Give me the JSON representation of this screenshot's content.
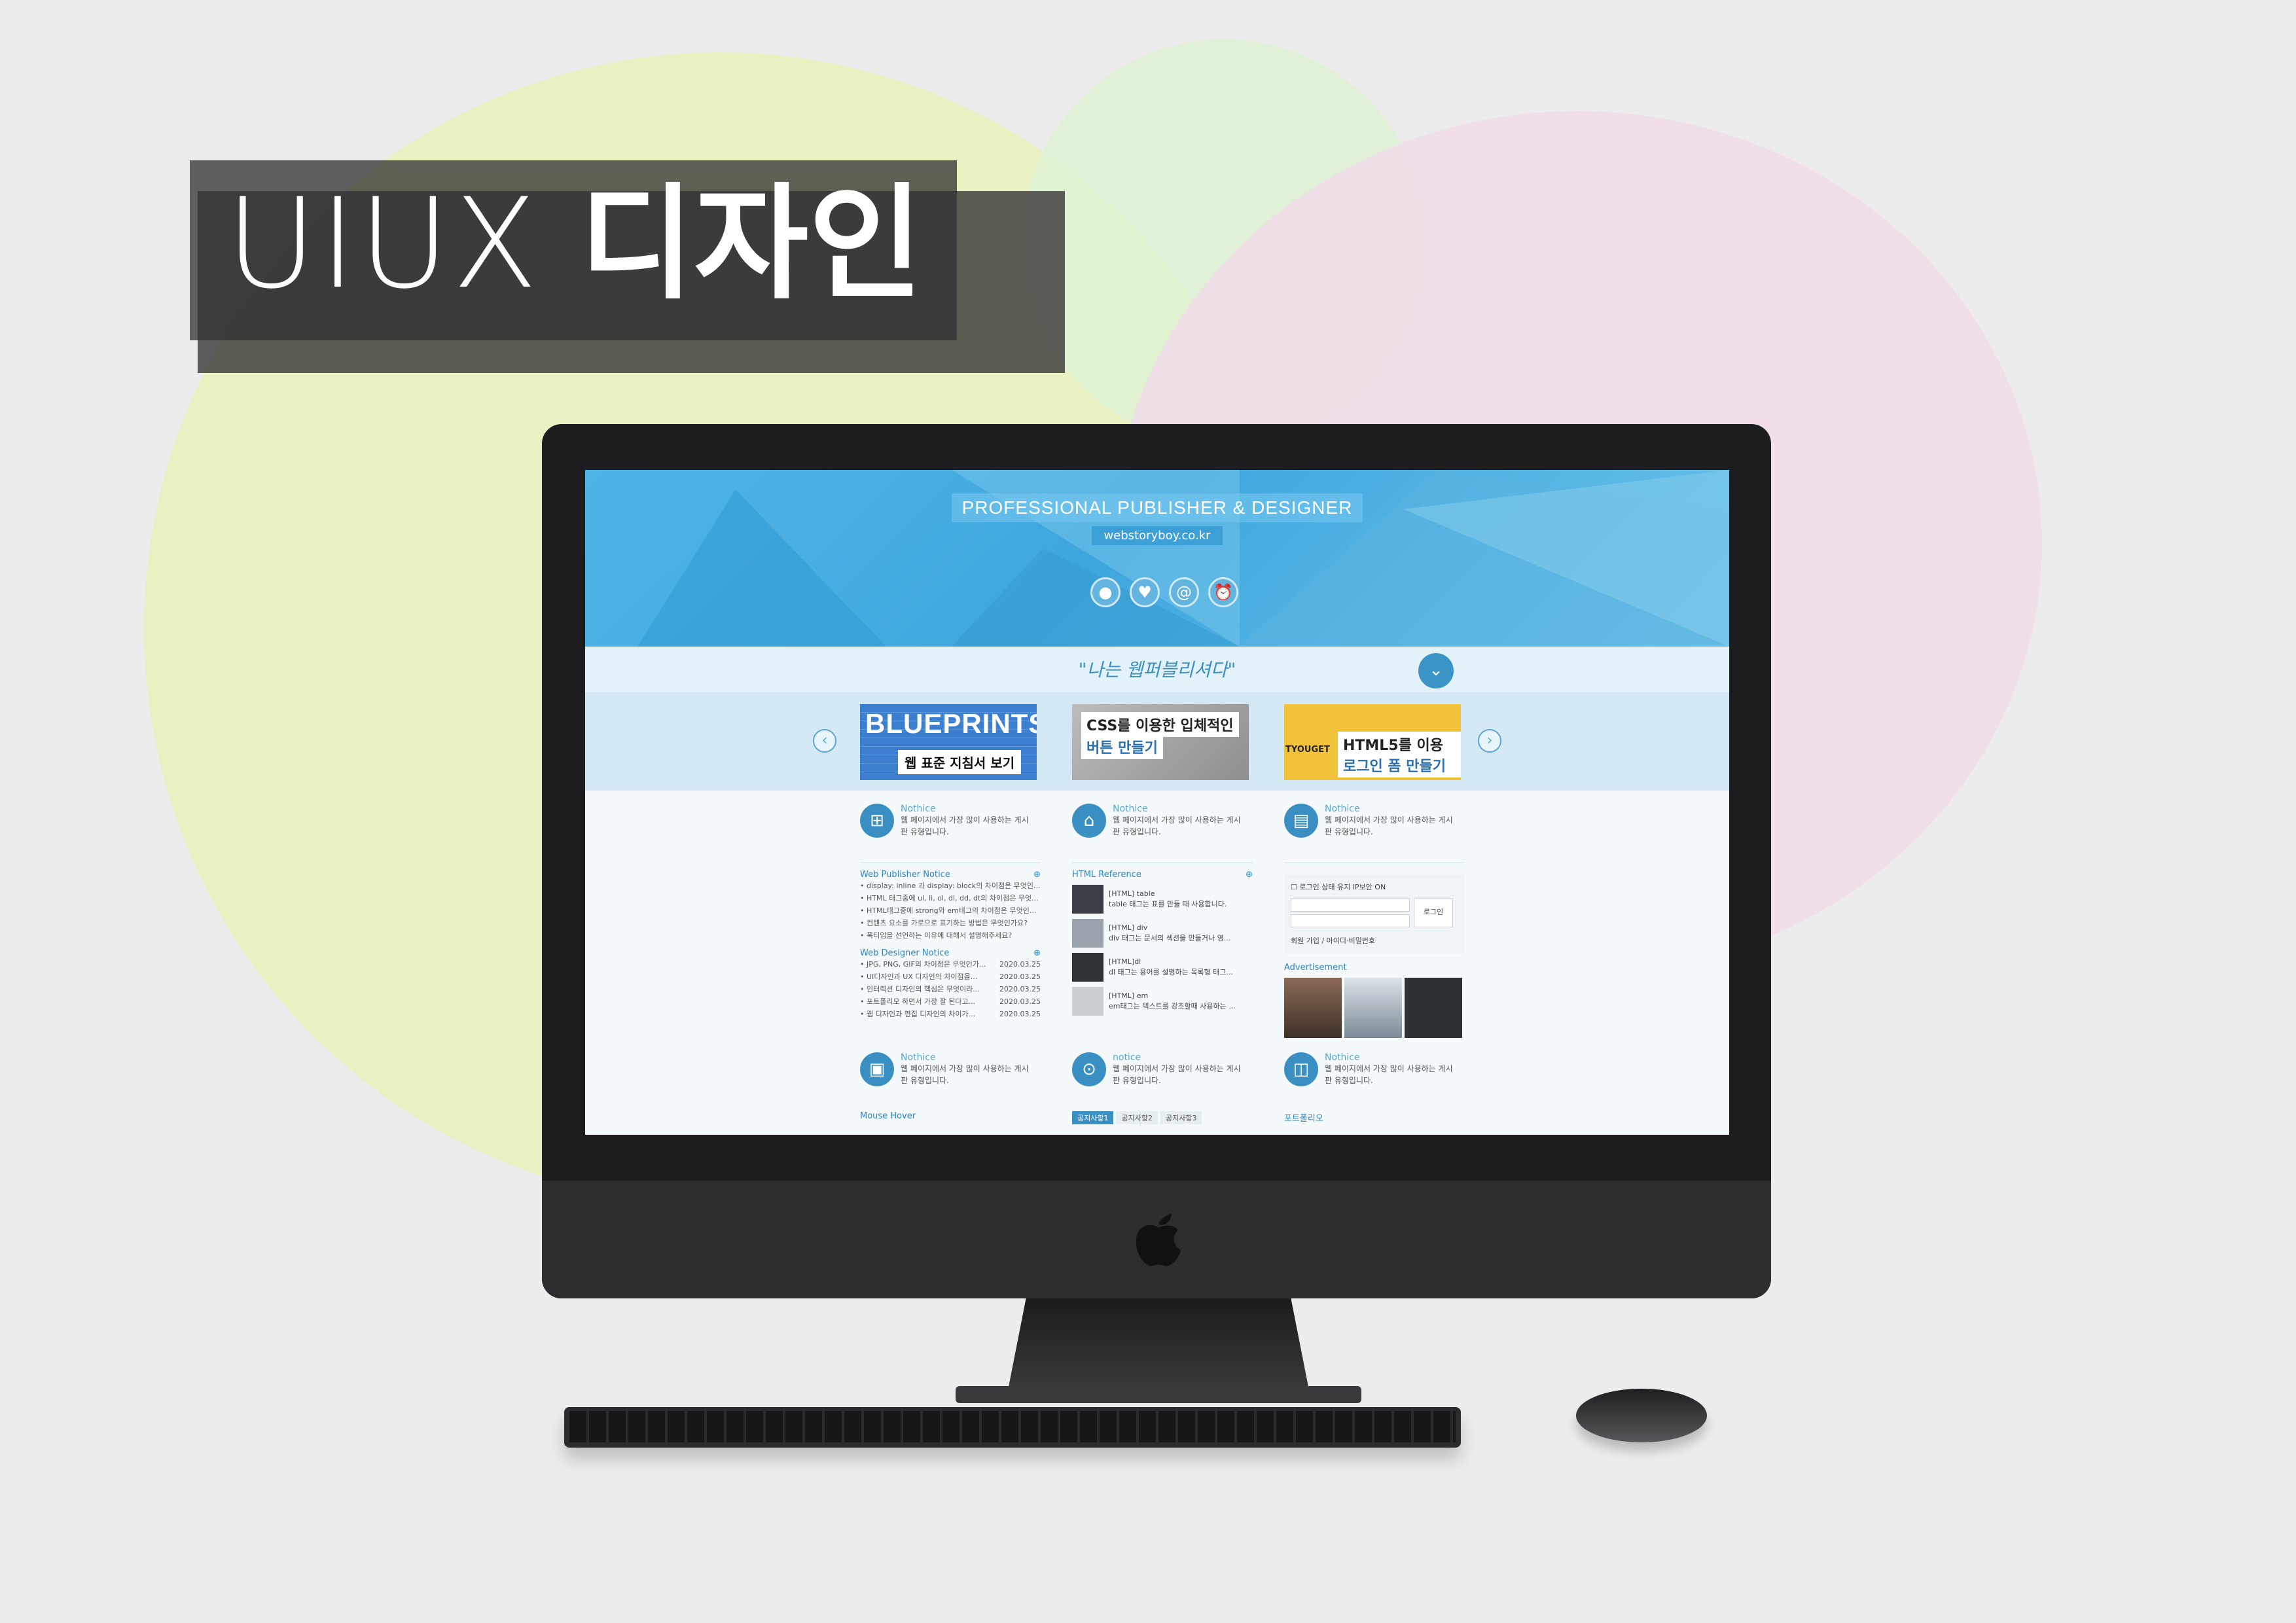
{
  "poster": {
    "title_en": "UIUX",
    "title_ko": "디자인"
  },
  "site": {
    "hero_title": "PROFESSIONAL PUBLISHER & DESIGNER",
    "hero_domain": "webstoryboy.co.kr",
    "hero_icons": [
      "●",
      "♥",
      "@",
      "⏰"
    ],
    "quote": "\"나는 웹퍼블리셔다\"",
    "down_arrow": "⌄",
    "prev_arrow": "‹",
    "next_arrow": "›",
    "banners": [
      {
        "big": "BLUEPRINTS",
        "small": "웹 표준 지침서 보기"
      },
      {
        "big": "CSS를 이용한 입체적인",
        "small": "버튼 만들기"
      },
      {
        "big": "HTML5를 이용한",
        "small": "로그인 폼 만들기",
        "tag": "TYOUGET"
      }
    ],
    "columns": [
      {
        "icon": "⊞",
        "title": "Nothice",
        "desc": "웹 페이지에서 가장 많이 사용하는 게시판 유형입니다.",
        "section1": "Web Publisher Notice",
        "items1": [
          "• display: inline 과 display: block의 차이점은 무엇인...",
          "• HTML 태그중에 ul, li, ol, dl, dd, dt의 차이점은 무엇...",
          "• HTML태그중에 strong와 em태그의 차이점은 무엇인...",
          "• 컨텐츠 요소를 가로으로 표기하는 방법은 무엇인가요?",
          "• 폭티입을 선언하는 이유에 대해서 설명해주세요?"
        ],
        "section2": "Web Designer Notice",
        "items2": [
          {
            "t": "• JPG, PNG, GIF의 차이점은 무엇인가...",
            "d": "2020.03.25"
          },
          {
            "t": "• UI디자인과 UX 디자인의 차이점을...",
            "d": "2020.03.25"
          },
          {
            "t": "• 인터렉션 디자인의 핵심은 무엇이라...",
            "d": "2020.03.25"
          },
          {
            "t": "• 포트폴리오 하면서 가장 잘 된다고...",
            "d": "2020.03.25"
          },
          {
            "t": "• 웹 디자인과 편집 디자인의 차이가...",
            "d": "2020.03.25"
          }
        ]
      },
      {
        "icon": "⌂",
        "title": "Nothice",
        "desc": "웹 페이지에서 가장 많이 사용하는 게시판 유형입니다.",
        "section1": "HTML Reference",
        "refs": [
          {
            "t": "[HTML] table",
            "d": "table 태그는 표를 만들 때 사용합니다."
          },
          {
            "t": "[HTML] div",
            "d": "div 태그는 문서의 섹션을 만들거나 영..."
          },
          {
            "t": "[HTML]dl",
            "d": "dl 태그는 용어를 설명하는 목록형 태그..."
          },
          {
            "t": "[HTML] em",
            "d": "em태그는 텍스트를 강조할때 사용하는 ..."
          }
        ]
      },
      {
        "icon": "▤",
        "title": "Nothice",
        "desc": "웹 페이지에서 가장 많이 사용하는 게시판 유형입니다.",
        "login_keep": "☐ 로그인 상태 유지   IP보안 ON",
        "login_btn": "로그인",
        "login_links": "회원 가입 / 아이디·비밀번호",
        "ad_title": "Advertisement"
      }
    ],
    "row2": [
      {
        "icon": "▣",
        "title": "Nothice",
        "desc": "웹 페이지에서 가장 많이 사용하는 게시판 유형입니다.",
        "section": "Mouse Hover"
      },
      {
        "icon": "⊙",
        "title": "notice",
        "desc": "웹 페이지에서 가장 많이 사용하는 게시판 유형입니다.",
        "tabs": [
          "공지사항1",
          "공지사항2",
          "공지사항3"
        ]
      },
      {
        "icon": "◫",
        "title": "Nothice",
        "desc": "웹 페이지에서 가장 많이 사용하는 게시판 유형입니다.",
        "section": "포트폴리오"
      }
    ]
  }
}
